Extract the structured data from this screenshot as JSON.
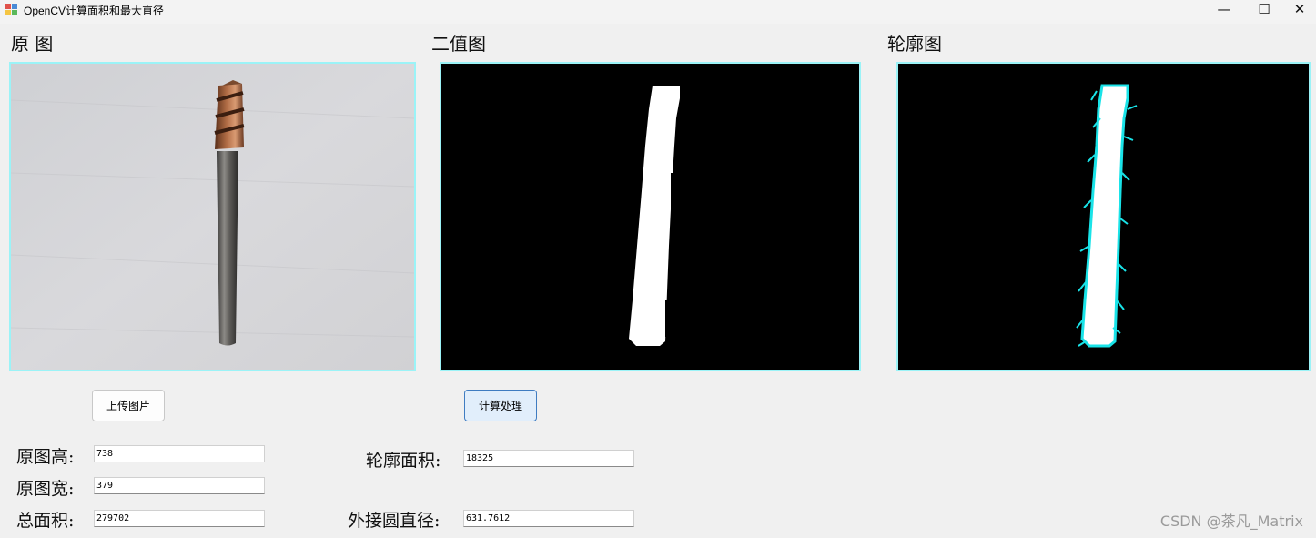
{
  "window": {
    "title": "OpenCV计算面积和最大直径",
    "minimize_glyph": "—",
    "maximize_glyph": "☐",
    "close_glyph": "✕"
  },
  "sections": {
    "original_title": "原 图",
    "binary_title": "二值图",
    "contour_title": "轮廓图"
  },
  "buttons": {
    "upload_label": "上传图片",
    "compute_label": "计算处理"
  },
  "fields": {
    "height_label": "原图高:",
    "height_value": "738",
    "width_label": "原图宽:",
    "width_value": "379",
    "total_area_label": "总面积:",
    "total_area_value": "279702",
    "contour_area_label": "轮廓面积:",
    "contour_area_value": "18325",
    "circle_diameter_label": "外接圆直径:",
    "circle_diameter_value": "631.7612"
  },
  "watermark": "CSDN @茶凡_Matrix",
  "colors": {
    "panel_border": "#9bf3f7",
    "contour_cyan": "#19e3e8",
    "active_button_border": "#3f7cc1"
  }
}
